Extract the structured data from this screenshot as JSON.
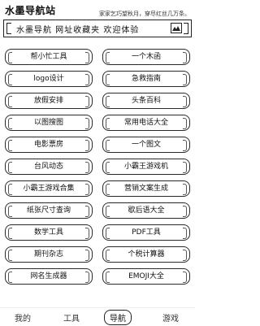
{
  "header": {
    "title": "水墨导航站",
    "slogan": "家家乞巧望秋月，穿尽红丝几万条。"
  },
  "banner": {
    "text": "水墨导航 网址收藏夹 欢迎体验",
    "icon": "ink-landscape-icon"
  },
  "links": [
    "帮小忙工具",
    "一个木函",
    "logo设计",
    "急救指南",
    "放假安排",
    "头条百科",
    "以图搜图",
    "常用电话大全",
    "电影票房",
    "一个图文",
    "台风动态",
    "小霸王游戏机",
    "小霸王游戏合集",
    "营销文案生成",
    "纸张尺寸查询",
    "歇后语大全",
    "数学工具",
    "PDF工具",
    "期刊杂志",
    "个税计算器",
    "网名生成器",
    "EMOJI大全"
  ],
  "tabs": [
    {
      "label": "我的",
      "active": false
    },
    {
      "label": "工具",
      "active": false
    },
    {
      "label": "导航",
      "active": true
    },
    {
      "label": "游戏",
      "active": false
    }
  ],
  "colors": {
    "ink": "#222222",
    "background": "#ffffff"
  }
}
